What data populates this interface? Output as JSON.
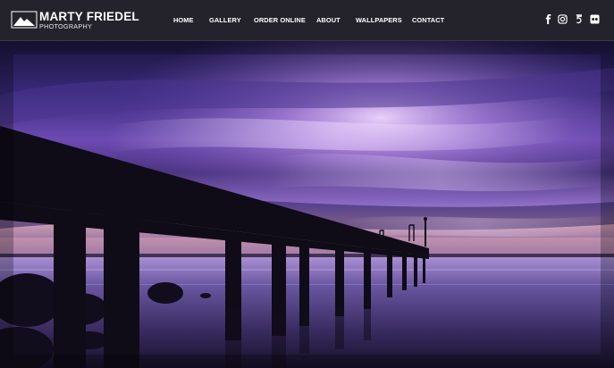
{
  "brand": {
    "name": "MARTY FRIEDEL",
    "sub": "PHOTOGRAPHY"
  },
  "nav": {
    "items": [
      {
        "label": "HOME"
      },
      {
        "label": "GALLERY"
      },
      {
        "label": "ORDER ONLINE"
      },
      {
        "label": "ABOUT"
      },
      {
        "label": "WALLPAPERS"
      },
      {
        "label": "CONTACT"
      }
    ]
  },
  "social": {
    "icons": [
      "facebook-icon",
      "instagram-icon",
      "500px-icon",
      "flickr-icon"
    ]
  },
  "hero": {
    "subject": "pier at dusk over water with purple sky"
  },
  "colors": {
    "header_bg": "#24222b",
    "sky_top": "#2a1e5a",
    "sky_glow": "#b58ae6",
    "water": "#4a3a78"
  }
}
